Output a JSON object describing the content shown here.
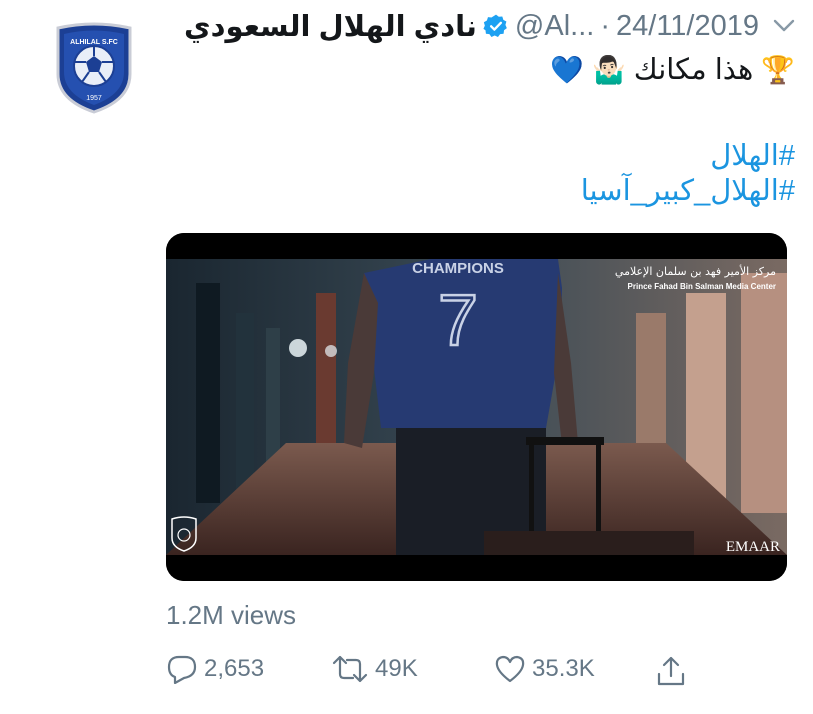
{
  "tweet": {
    "display_name": "نادي الهلال السعودي",
    "handle": "@Al...",
    "separator": "·",
    "date": "24/11/2019",
    "text": "هذا مكانك",
    "emoji_trophy": "🏆",
    "emoji_shrug": "🤷🏻‍♂️",
    "emoji_heart": "💙",
    "hashtags": [
      "#الهلال",
      "#الهلال_كبير_آسيا"
    ]
  },
  "media": {
    "overlay_arabic": "مركز الأمير فهد بن سلمان الإعلامي",
    "overlay_english": "Prince Fahad Bin Salman Media Center",
    "jersey_text": "CHAMPIONS",
    "jersey_number": "7",
    "watermark": "EMAAR"
  },
  "stats": {
    "views": "1.2M views",
    "replies": "2,653",
    "retweets": "49K",
    "likes": "35.3K"
  },
  "avatar": {
    "logo_text": "ALHILAL S.FC",
    "logo_year": "1957"
  },
  "colors": {
    "link": "#1b95e0",
    "verified": "#1da1f2",
    "muted": "#657786",
    "hilal_blue": "#1c3f94"
  },
  "icons": [
    "verified-badge-icon",
    "chevron-down-icon",
    "reply-icon",
    "retweet-icon",
    "like-icon",
    "share-icon"
  ]
}
